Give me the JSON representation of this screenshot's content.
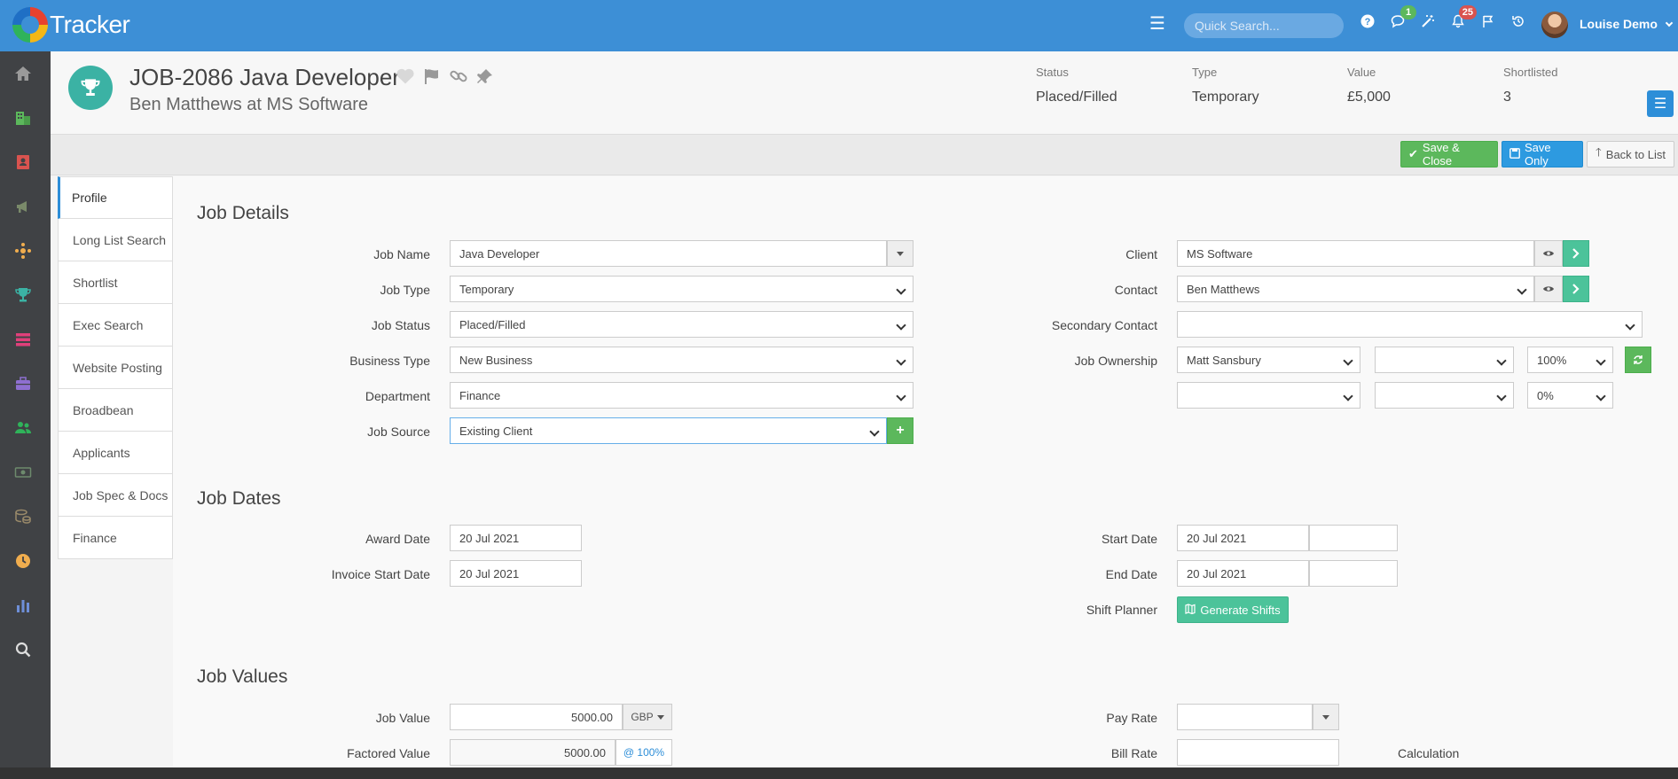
{
  "app": {
    "name": "Tracker"
  },
  "topbar": {
    "search_placeholder": "Quick Search...",
    "messages_count": "1",
    "notifications_count": "25",
    "user_name": "Louise Demo"
  },
  "header": {
    "title": "JOB-2086 Java Developer",
    "subtitle": "Ben Matthews at MS Software",
    "stats": [
      {
        "label": "Status",
        "value": "Placed/Filled"
      },
      {
        "label": "Type",
        "value": "Temporary"
      },
      {
        "label": "Value",
        "value": "£5,000"
      },
      {
        "label": "Shortlisted",
        "value": "3"
      }
    ]
  },
  "actions": {
    "save_close": "Save & Close",
    "save_only": "Save Only",
    "back_to_list": "Back to List"
  },
  "tabs": [
    "Profile",
    "Long List Search",
    "Shortlist",
    "Exec Search",
    "Website Posting",
    "Broadbean",
    "Applicants",
    "Job Spec & Docs",
    "Finance"
  ],
  "job_details": {
    "title": "Job Details",
    "job_name_label": "Job Name",
    "job_name": "Java Developer",
    "job_type_label": "Job Type",
    "job_type": "Temporary",
    "job_status_label": "Job Status",
    "job_status": "Placed/Filled",
    "business_type_label": "Business Type",
    "business_type": "New Business",
    "department_label": "Department",
    "department": "Finance",
    "job_source_label": "Job Source",
    "job_source": "Existing Client",
    "client_label": "Client",
    "client": "MS Software",
    "contact_label": "Contact",
    "contact": "Ben Matthews",
    "secondary_contact_label": "Secondary Contact",
    "secondary_contact": "",
    "job_ownership_label": "Job Ownership",
    "owner_1": "Matt Sansbury",
    "owner_1_pct": "100%",
    "owner_3_pct": "0%"
  },
  "job_dates": {
    "title": "Job Dates",
    "award_date_label": "Award Date",
    "award_date": "20 Jul 2021",
    "invoice_start_label": "Invoice Start Date",
    "invoice_start": "20 Jul 2021",
    "start_date_label": "Start Date",
    "start_date": "20 Jul 2021",
    "end_date_label": "End Date",
    "end_date": "20 Jul 2021",
    "shift_planner_label": "Shift Planner",
    "generate_shifts": "Generate Shifts"
  },
  "job_values": {
    "title": "Job Values",
    "job_value_label": "Job Value",
    "job_value": "5000.00",
    "currency": "GBP",
    "factored_value_label": "Factored Value",
    "factored_value": "5000.00",
    "factor": "@ 100%",
    "pay_rate_label": "Pay Rate",
    "bill_rate_label": "Bill Rate",
    "calculation_label": "Calculation"
  },
  "colors": {
    "topbar": "#3d8fd6",
    "sidebar": "#404245",
    "accent_teal": "#3bb2a4",
    "save_green": "#5cb85c",
    "save_blue": "#2d9ae0"
  }
}
